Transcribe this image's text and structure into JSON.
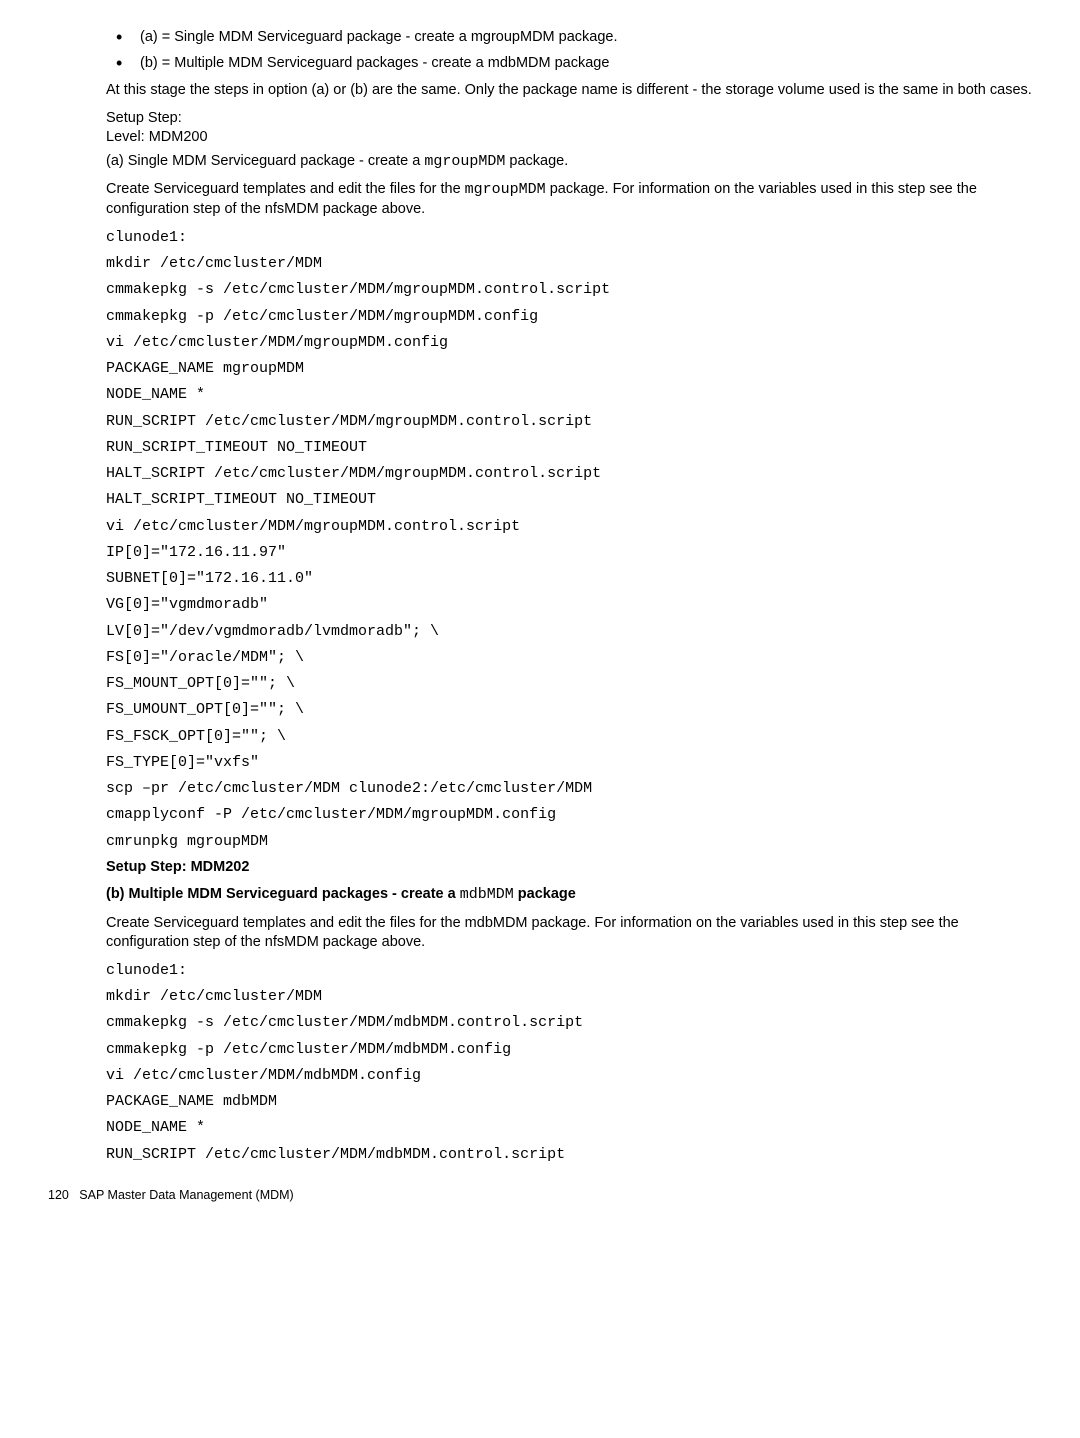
{
  "bullets": {
    "a": "(a) = Single MDM Serviceguard package - create a mgroupMDM package.",
    "b": "(b) = Multiple MDM Serviceguard packages - create a mdbMDM package"
  },
  "intro": "At this stage the steps in option (a) or (b) are the same. Only the package name is different - the storage volume used is the same in both cases.",
  "setup200_l1": "Setup Step:",
  "setup200_l2": "Level: MDM200",
  "a_title_pre": "(a) Single MDM Serviceguard package - create a ",
  "a_title_m": "mgroupMDM",
  "a_title_post": " package.",
  "a_desc_pre": "Create Serviceguard templates and edit the files for the ",
  "a_desc_m": "mgroupMDM",
  "a_desc_post": " package. For information on the variables used in this step see the configuration step of the nfsMDM package above.",
  "code_a": {
    "l1": "clunode1:",
    "l2": "mkdir /etc/cmcluster/MDM",
    "l3": "cmmakepkg -s /etc/cmcluster/MDM/mgroupMDM.control.script",
    "l4": "cmmakepkg -p /etc/cmcluster/MDM/mgroupMDM.config",
    "l5": "vi /etc/cmcluster/MDM/mgroupMDM.config",
    "l6": "PACKAGE_NAME mgroupMDM",
    "l7": "NODE_NAME *",
    "l8": "RUN_SCRIPT /etc/cmcluster/MDM/mgroupMDM.control.script",
    "l9": "RUN_SCRIPT_TIMEOUT NO_TIMEOUT",
    "l10": "HALT_SCRIPT /etc/cmcluster/MDM/mgroupMDM.control.script",
    "l11": "HALT_SCRIPT_TIMEOUT NO_TIMEOUT",
    "l12": "vi /etc/cmcluster/MDM/mgroupMDM.control.script",
    "l13": "IP[0]=\"172.16.11.97\"",
    "l14": "SUBNET[0]=\"172.16.11.0\"",
    "l15": "VG[0]=\"vgmdmoradb\"",
    "l16": "LV[0]=\"/dev/vgmdmoradb/lvmdmoradb\"; \\",
    "l17": "FS[0]=\"/oracle/MDM\"; \\",
    "l18": "FS_MOUNT_OPT[0]=\"\"; \\",
    "l19": "FS_UMOUNT_OPT[0]=\"\"; \\",
    "l20": "FS_FSCK_OPT[0]=\"\"; \\",
    "l21": "FS_TYPE[0]=\"vxfs\"",
    "l22": "scp –pr /etc/cmcluster/MDM clunode2:/etc/cmcluster/MDM",
    "l23": "cmapplyconf -P /etc/cmcluster/MDM/mgroupMDM.config",
    "l24": "cmrunpkg mgroupMDM"
  },
  "setup202": "Setup Step: MDM202",
  "b_title_pre": "(b) Multiple MDM Serviceguard packages - create a ",
  "b_title_m": "mdbMDM",
  "b_title_post": " package",
  "b_desc": "Create Serviceguard templates and edit the files for the mdbMDM package. For information on the variables used in this step see the configuration step of the nfsMDM package above.",
  "code_b": {
    "l1": "clunode1:",
    "l2": "mkdir /etc/cmcluster/MDM",
    "l3": "cmmakepkg -s /etc/cmcluster/MDM/mdbMDM.control.script",
    "l4": "cmmakepkg -p /etc/cmcluster/MDM/mdbMDM.config",
    "l5": "vi /etc/cmcluster/MDM/mdbMDM.config",
    "l6": "PACKAGE_NAME mdbMDM",
    "l7": "NODE_NAME *",
    "l8": "RUN_SCRIPT /etc/cmcluster/MDM/mdbMDM.control.script"
  },
  "footer_page": "120",
  "footer_text": "SAP Master Data Management (MDM)"
}
